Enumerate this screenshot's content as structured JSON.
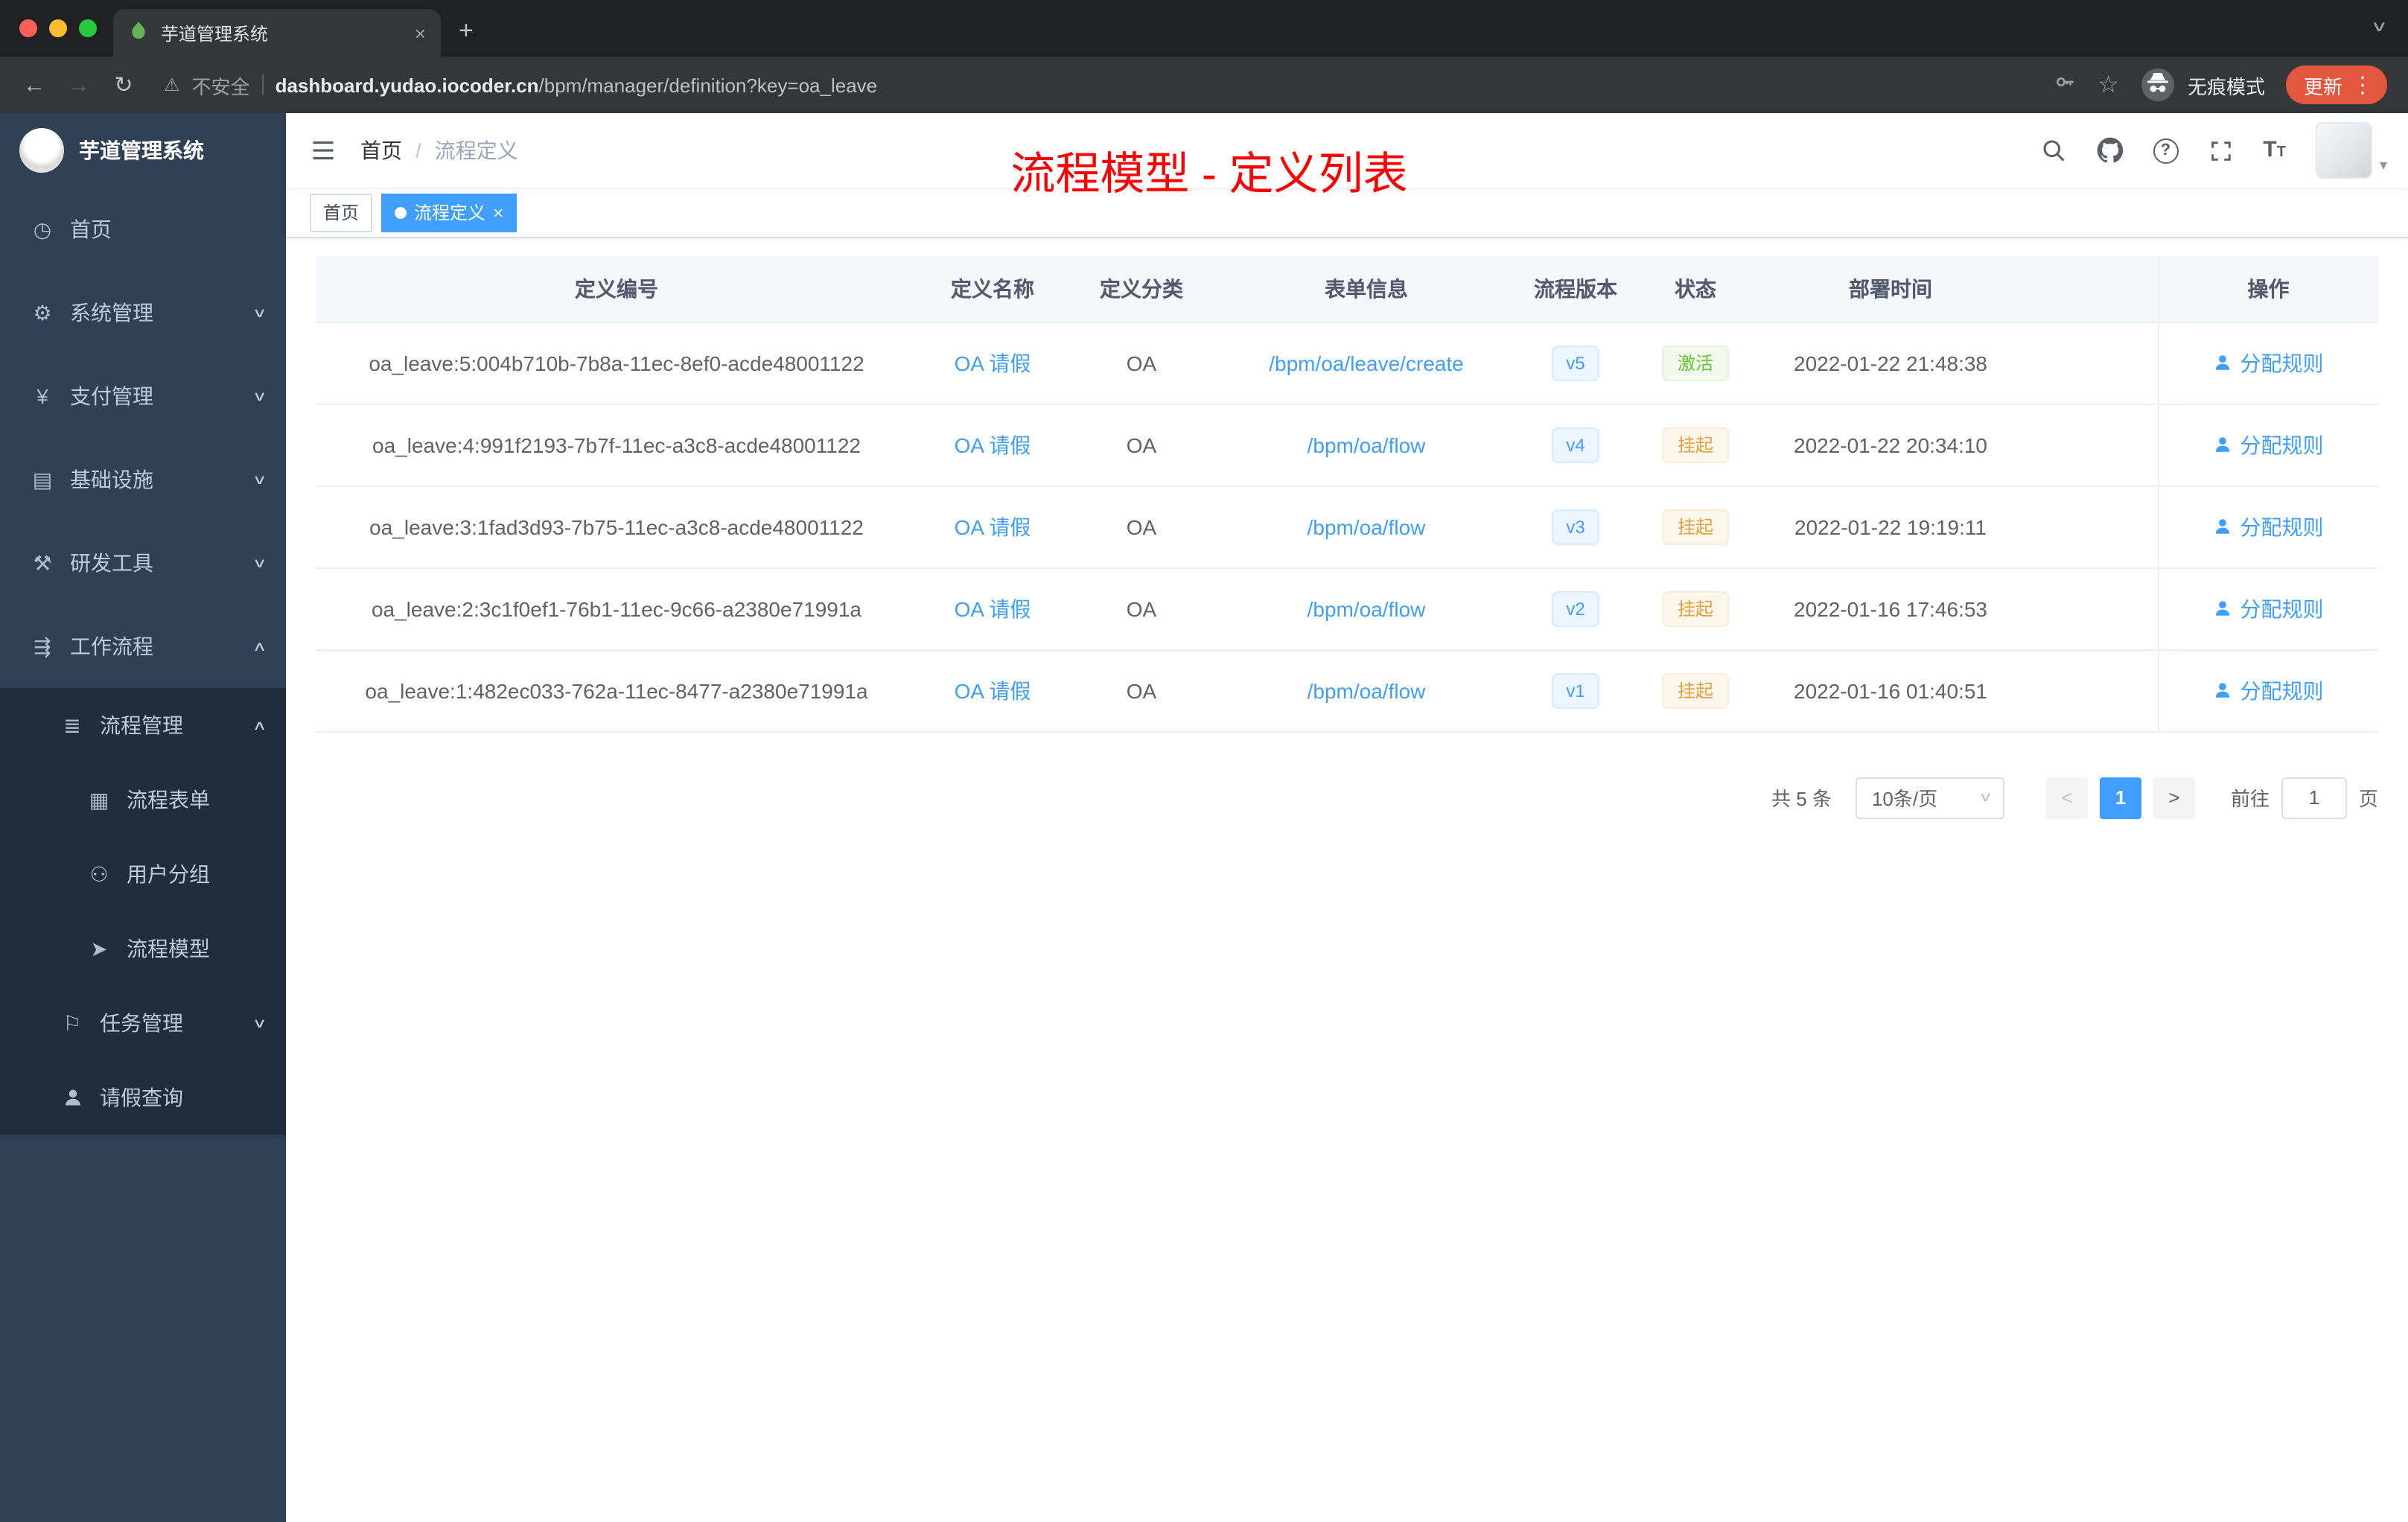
{
  "browser": {
    "tab_title": "芋道管理系统",
    "security_label": "不安全",
    "url_domain": "dashboard.yudao.iocoder.cn",
    "url_path": "/bpm/manager/definition?key=oa_leave",
    "incognito_label": "无痕模式",
    "update_label": "更新"
  },
  "icons": {
    "back": "←",
    "forward": "→",
    "reload": "↻",
    "warning": "⚠",
    "star": "☆",
    "more": "⋮",
    "chevron_down": "∨",
    "chevron_up": "∧",
    "close": "×",
    "plus": "+",
    "breadcrumb_sep": "/",
    "angle_left": "<",
    "angle_right": ">",
    "caret_down": "▾",
    "question": "?",
    "t_large": "T",
    "t_small": "T",
    "dashboard": "◷",
    "gear": "⚙",
    "yen": "¥",
    "infrastructure": "▤",
    "tools": "⚒",
    "workflow": "⇶",
    "process_list": "≣",
    "form": "▦",
    "user_group": "⚇",
    "paper_plane": "➤",
    "task": "⚐"
  },
  "sidebar": {
    "logo_title": "芋道管理系统",
    "items": [
      {
        "label": "首页"
      },
      {
        "label": "系统管理"
      },
      {
        "label": "支付管理"
      },
      {
        "label": "基础设施"
      },
      {
        "label": "研发工具"
      },
      {
        "label": "工作流程"
      },
      {
        "label": "流程管理"
      },
      {
        "label": "流程表单"
      },
      {
        "label": "用户分组"
      },
      {
        "label": "流程模型"
      },
      {
        "label": "任务管理"
      },
      {
        "label": "请假查询"
      }
    ]
  },
  "header": {
    "breadcrumb": [
      "首页",
      "流程定义"
    ],
    "annotation": "流程模型 - 定义列表"
  },
  "tags": [
    {
      "label": "首页",
      "active": false
    },
    {
      "label": "流程定义",
      "active": true
    }
  ],
  "table": {
    "columns": [
      "定义编号",
      "定义名称",
      "定义分类",
      "表单信息",
      "流程版本",
      "状态",
      "部署时间",
      "操作"
    ],
    "rows": [
      {
        "id": "oa_leave:5:004b710b-7b8a-11ec-8ef0-acde48001122",
        "name": "OA 请假",
        "category": "OA",
        "form": "/bpm/oa/leave/create",
        "version": "v5",
        "status": "激活",
        "deployed": "2022-01-22 21:48:38",
        "action": "分配规则"
      },
      {
        "id": "oa_leave:4:991f2193-7b7f-11ec-a3c8-acde48001122",
        "name": "OA 请假",
        "category": "OA",
        "form": "/bpm/oa/flow",
        "version": "v4",
        "status": "挂起",
        "deployed": "2022-01-22 20:34:10",
        "action": "分配规则"
      },
      {
        "id": "oa_leave:3:1fad3d93-7b75-11ec-a3c8-acde48001122",
        "name": "OA 请假",
        "category": "OA",
        "form": "/bpm/oa/flow",
        "version": "v3",
        "status": "挂起",
        "deployed": "2022-01-22 19:19:11",
        "action": "分配规则"
      },
      {
        "id": "oa_leave:2:3c1f0ef1-76b1-11ec-9c66-a2380e71991a",
        "name": "OA 请假",
        "category": "OA",
        "form": "/bpm/oa/flow",
        "version": "v2",
        "status": "挂起",
        "deployed": "2022-01-16 17:46:53",
        "action": "分配规则"
      },
      {
        "id": "oa_leave:1:482ec033-762a-11ec-8477-a2380e71991a",
        "name": "OA 请假",
        "category": "OA",
        "form": "/bpm/oa/flow",
        "version": "v1",
        "status": "挂起",
        "deployed": "2022-01-16 01:40:51",
        "action": "分配规则"
      }
    ]
  },
  "pagination": {
    "total": "共 5 条",
    "page_size": "10条/页",
    "page": "1",
    "goto_label": "前往",
    "goto_value": "1",
    "unit": "页"
  },
  "colors": {
    "accent": "#409eff",
    "success": "#67c23a",
    "warning": "#e6a23c",
    "annotation_red": "#ff0000",
    "sidebar_bg": "#304156",
    "submenu_bg": "#1f2d3d",
    "browser_frame": "#202124",
    "browser_toolbar": "#35363a",
    "update_pill": "#e2573e"
  }
}
